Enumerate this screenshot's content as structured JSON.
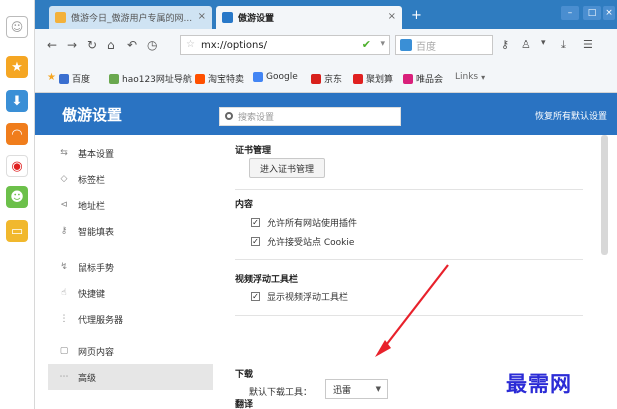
{
  "dock": {
    "items": [
      "smiley-icon",
      "favorites-star-icon",
      "download-icon",
      "rss-icon",
      "weibo-icon",
      "emoji-icon",
      "notes-icon"
    ]
  },
  "tabs": {
    "inactive_label": "傲游今日_傲游用户专属的网...",
    "active_label": "傲游设置",
    "close_glyph": "×",
    "new_tab_glyph": "+"
  },
  "nav": {
    "url": "mx://options/",
    "search_placeholder": "百度"
  },
  "bookmarks": [
    {
      "label": "百度",
      "color": "#3a6fd0"
    },
    {
      "label": "hao123网址导航",
      "color": "#6aa84f"
    },
    {
      "label": "淘宝特卖",
      "color": "#ff5000"
    },
    {
      "label": "Google",
      "color": "#4285f4"
    },
    {
      "label": "京东",
      "color": "#d8201c"
    },
    {
      "label": "聚划算",
      "color": "#e02020"
    },
    {
      "label": "唯品会",
      "color": "#d9207b"
    },
    {
      "label": "Links",
      "color": "#999999"
    }
  ],
  "header": {
    "title": "傲游设置",
    "search_placeholder": "搜索设置",
    "restore_label": "恢复所有默认设置",
    "color": "#2a73c2"
  },
  "sidebar": {
    "items": [
      {
        "label": "基本设置",
        "icon": "sliders-icon"
      },
      {
        "label": "标签栏",
        "icon": "tag-icon"
      },
      {
        "label": "地址栏",
        "icon": "address-icon"
      },
      {
        "label": "智能填表",
        "icon": "key-icon"
      },
      {
        "label": "鼠标手势",
        "icon": "gesture-icon"
      },
      {
        "label": "快捷键",
        "icon": "hand-icon"
      },
      {
        "label": "代理服务器",
        "icon": "proxy-icon"
      },
      {
        "label": "网页内容",
        "icon": "page-icon"
      },
      {
        "label": "高级",
        "icon": "more-icon"
      }
    ],
    "active_index": 8
  },
  "content": {
    "cert": {
      "title": "证书管理",
      "button": "进入证书管理"
    },
    "content_sect": {
      "title": "内容",
      "options": [
        {
          "label": "允许所有网站使用插件",
          "checked": true
        },
        {
          "label": "允许接受站点 Cookie",
          "checked": true
        }
      ]
    },
    "video": {
      "title": "视频浮动工具栏",
      "options": [
        {
          "label": "显示视频浮动工具栏",
          "checked": true
        }
      ]
    },
    "download": {
      "title": "下载",
      "label": "默认下载工具：",
      "selected": "迅雷"
    },
    "next_title": "翻译"
  },
  "watermark": "最需网"
}
